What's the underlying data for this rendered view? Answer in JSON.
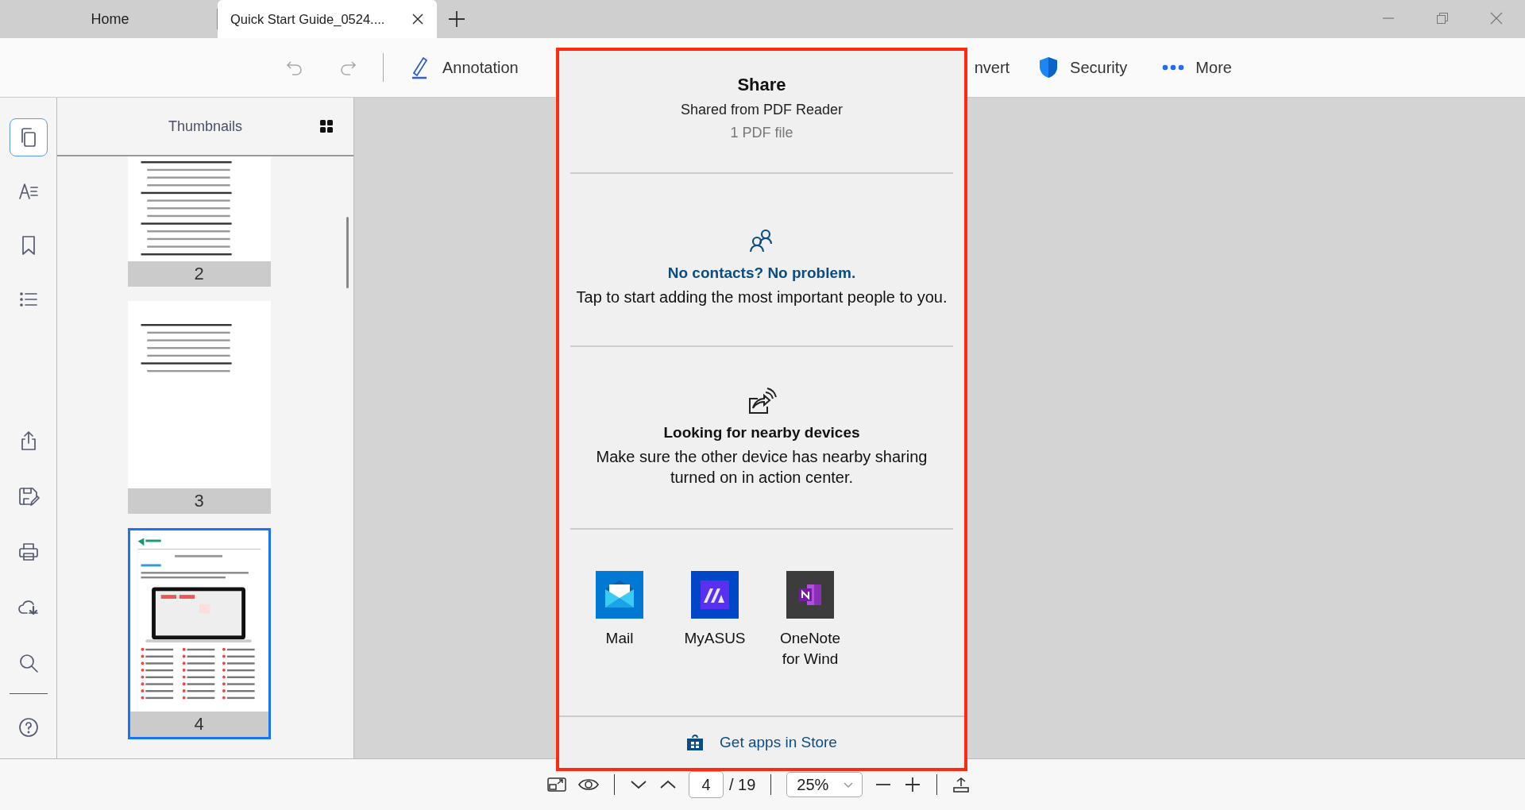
{
  "tabs": [
    {
      "label": "Home",
      "selected": false,
      "closable": false
    },
    {
      "label": "Quick Start Guide_0524....",
      "selected": true,
      "closable": true
    }
  ],
  "toolbar": [
    {
      "kind": "undo",
      "disabled": true
    },
    {
      "kind": "redo",
      "disabled": true
    },
    {
      "kind": "annotation",
      "label": "Annotation",
      "disabled": false
    },
    {
      "kind": "convert",
      "label": "nvert",
      "disabled": false
    },
    {
      "kind": "security",
      "label": "Security",
      "disabled": false
    },
    {
      "kind": "more",
      "label": "More",
      "disabled": false
    }
  ],
  "rail": {
    "top": [
      {
        "kind": "pages",
        "selected": true
      },
      {
        "kind": "text",
        "selected": false
      },
      {
        "kind": "bookmark",
        "selected": false
      },
      {
        "kind": "outline",
        "selected": false
      }
    ],
    "tools": [
      {
        "kind": "share",
        "selected": false
      },
      {
        "kind": "save",
        "selected": false
      },
      {
        "kind": "print",
        "selected": false
      },
      {
        "kind": "cloud",
        "selected": false
      },
      {
        "kind": "search",
        "selected": false
      }
    ],
    "help": [
      {
        "kind": "help",
        "selected": false
      }
    ]
  },
  "thumbnails": {
    "title": "Thumbnails",
    "pages": [
      {
        "number": "2",
        "kind": "contents-cut",
        "selected": false
      },
      {
        "number": "3",
        "kind": "contents",
        "selected": false
      },
      {
        "number": "4",
        "kind": "overview",
        "selected": true
      }
    ]
  },
  "bottom_bar": {
    "page_input": "4",
    "page_total": "/ 19",
    "zoom": "25%"
  },
  "share": {
    "title": "Share",
    "subtitle": "Shared from PDF Reader",
    "file_count": "1 PDF file",
    "contacts": {
      "heading": "No contacts? No problem.",
      "text": "Tap to start adding the most important people to you."
    },
    "nearby": {
      "heading": "Looking for nearby devices",
      "text": "Make sure the other device has nearby sharing turned on in action center."
    },
    "apps": [
      {
        "kind": "mail",
        "label": "Mail"
      },
      {
        "kind": "myasus",
        "label": "MyASUS"
      },
      {
        "kind": "onenote",
        "label": "OneNote for Wind"
      }
    ],
    "store_link": "Get apps in Store"
  }
}
